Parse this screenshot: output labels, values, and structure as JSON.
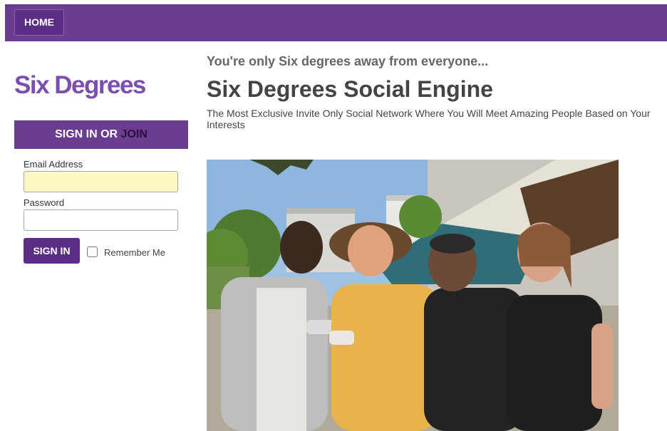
{
  "nav": {
    "home_label": "HOME"
  },
  "sidebar": {
    "logo_text": "Six Degrees",
    "signin_header": {
      "signin_text": "SIGN IN OR ",
      "join_text": "JOIN"
    },
    "email": {
      "label": "Email Address",
      "value": ""
    },
    "password": {
      "label": "Password",
      "value": ""
    },
    "signin_button_label": "SIGN IN",
    "remember_me_label": "Remember Me",
    "remember_me_checked": false
  },
  "main": {
    "tagline": "You're only Six degrees away from everyone...",
    "title": "Six Degrees Social Engine",
    "description": "The Most Exclusive Invite Only Social Network Where You Will Meet Amazing People Based on Your Interests"
  },
  "colors": {
    "brand_purple": "#6a3d8f",
    "button_purple": "#5b2d86",
    "logo_purple": "#7b4fad",
    "autofill_yellow": "#fdf7c3"
  },
  "photo": {
    "subject": "group-of-four-friends-outdoors"
  }
}
